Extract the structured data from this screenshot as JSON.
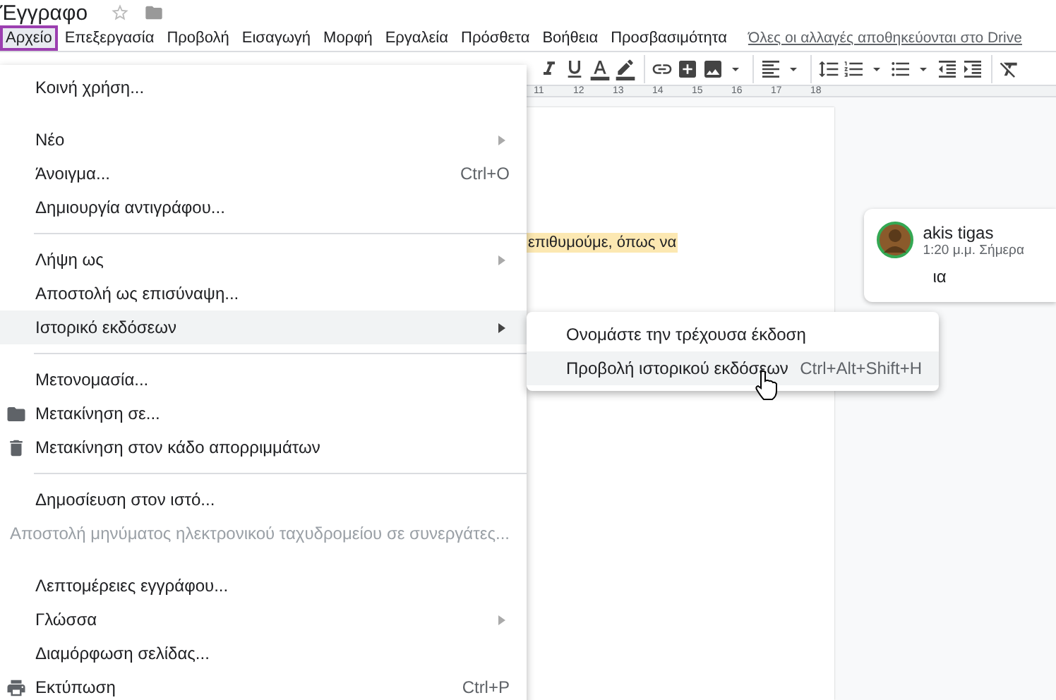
{
  "document": {
    "title": "Έγγραφο"
  },
  "menubar": {
    "items": [
      {
        "label": "Αρχείο",
        "selected": true
      },
      {
        "label": "Επεξεργασία",
        "selected": false
      },
      {
        "label": "Προβολή",
        "selected": false
      },
      {
        "label": "Εισαγωγή",
        "selected": false
      },
      {
        "label": "Μορφή",
        "selected": false
      },
      {
        "label": "Εργαλεία",
        "selected": false
      },
      {
        "label": "Πρόσθετα",
        "selected": false
      },
      {
        "label": "Βοήθεια",
        "selected": false
      },
      {
        "label": "Προσβασιμότητα",
        "selected": false
      }
    ],
    "save_status": "Όλες οι αλλαγές αποθηκεύονται στο Drive"
  },
  "ruler": {
    "labels": [
      "11",
      "12",
      "13",
      "14",
      "15",
      "16",
      "17",
      "18"
    ]
  },
  "document_body": {
    "highlighted_text": "επιθυμούμε, όπως να"
  },
  "comment": {
    "author": "akis tigas",
    "time": "1:20 μ.μ. Σήμερα",
    "text": "ια"
  },
  "file_menu": {
    "items": [
      {
        "kind": "item",
        "label": "Κοινή χρήση...",
        "selected": false,
        "disabled": false
      },
      {
        "kind": "spacer"
      },
      {
        "kind": "item",
        "label": "Νέο",
        "submenu": true,
        "selected": false,
        "disabled": false
      },
      {
        "kind": "item",
        "label": "Άνοιγμα...",
        "shortcut": "Ctrl+O",
        "selected": false,
        "disabled": false
      },
      {
        "kind": "item",
        "label": "Δημιουργία αντιγράφου...",
        "selected": false,
        "disabled": false
      },
      {
        "kind": "separator"
      },
      {
        "kind": "item",
        "label": "Λήψη ως",
        "submenu": true,
        "selected": false,
        "disabled": false
      },
      {
        "kind": "item",
        "label": "Αποστολή ως επισύναψη...",
        "selected": false,
        "disabled": false
      },
      {
        "kind": "item",
        "label": "Ιστορικό εκδόσεων",
        "submenu": true,
        "selected": true,
        "disabled": false
      },
      {
        "kind": "separator"
      },
      {
        "kind": "item",
        "label": "Μετονομασία...",
        "selected": false,
        "disabled": false
      },
      {
        "kind": "item",
        "label": "Μετακίνηση σε...",
        "selected": false,
        "disabled": false
      },
      {
        "kind": "item",
        "label": "Μετακίνηση στον κάδο απορριμμάτων",
        "selected": false,
        "disabled": false
      },
      {
        "kind": "separator"
      },
      {
        "kind": "item",
        "label": "Δημοσίευση στον ιστό...",
        "selected": false,
        "disabled": false
      },
      {
        "kind": "item",
        "label": "Αποστολή μηνύματος ηλεκτρονικού ταχυδρομείου σε συνεργάτες...",
        "selected": false,
        "disabled": true
      },
      {
        "kind": "spacer"
      },
      {
        "kind": "item",
        "label": "Λεπτομέρειες εγγράφου...",
        "selected": false,
        "disabled": false
      },
      {
        "kind": "item",
        "label": "Γλώσσα",
        "submenu": true,
        "selected": false,
        "disabled": false
      },
      {
        "kind": "item",
        "label": "Διαμόρφωση σελίδας...",
        "selected": false,
        "disabled": false
      },
      {
        "kind": "item",
        "label": "Εκτύπωση",
        "shortcut": "Ctrl+P",
        "selected": false,
        "disabled": false
      }
    ]
  },
  "submenu": {
    "items": [
      {
        "label": "Ονομάστε την τρέχουσα έκδοση",
        "selected": false
      },
      {
        "label": "Προβολή ιστορικού εκδόσεων",
        "shortcut": "Ctrl+Alt+Shift+H",
        "selected": true
      }
    ]
  }
}
